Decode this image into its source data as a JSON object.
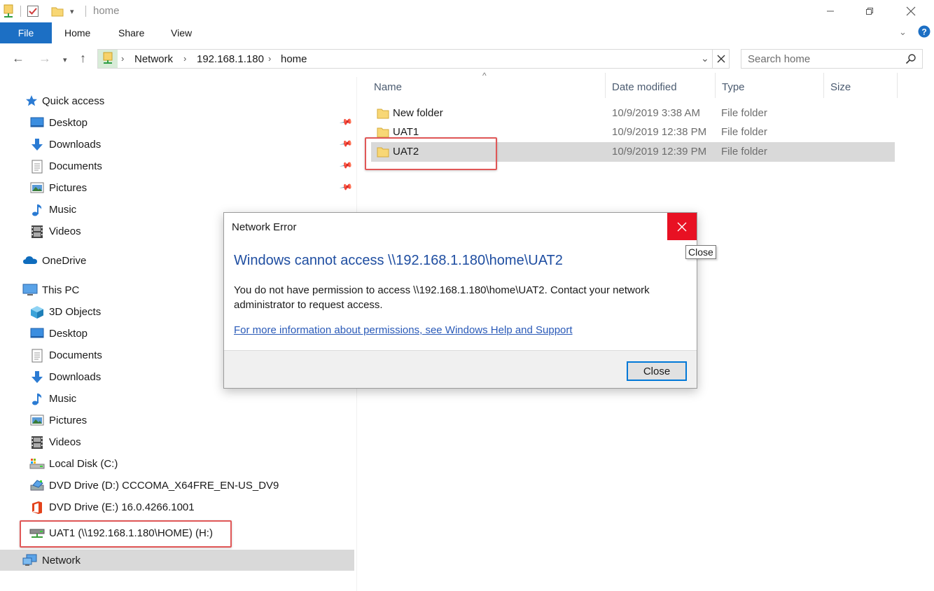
{
  "window": {
    "title": "home",
    "minimize_icon": "minimize-icon",
    "restore_icon": "restore-icon",
    "close_icon": "close-icon"
  },
  "ribbon": {
    "file": "File",
    "tabs": [
      "Home",
      "Share",
      "View"
    ]
  },
  "address": {
    "crumbs": [
      "Network",
      "192.168.1.180",
      "home"
    ]
  },
  "search": {
    "placeholder": "Search home"
  },
  "nav": {
    "quick_access": "Quick access",
    "quick_items": [
      "Desktop",
      "Downloads",
      "Documents",
      "Pictures",
      "Music",
      "Videos"
    ],
    "onedrive": "OneDrive",
    "this_pc": "This PC",
    "pc_items": [
      "3D Objects",
      "Desktop",
      "Documents",
      "Downloads",
      "Music",
      "Pictures",
      "Videos",
      "Local Disk (C:)",
      "DVD Drive (D:) CCCOMA_X64FRE_EN-US_DV9",
      "DVD Drive (E:) 16.0.4266.1001",
      "UAT1 (\\\\192.168.1.180\\HOME) (H:)"
    ],
    "network": "Network"
  },
  "columns": {
    "name": "Name",
    "date": "Date modified",
    "type": "Type",
    "size": "Size"
  },
  "files": [
    {
      "name": "New folder",
      "date": "10/9/2019 3:38 AM",
      "type": "File folder"
    },
    {
      "name": "UAT1",
      "date": "10/9/2019 12:38 PM",
      "type": "File folder"
    },
    {
      "name": "UAT2",
      "date": "10/9/2019 12:39 PM",
      "type": "File folder"
    }
  ],
  "dialog": {
    "title": "Network Error",
    "heading": "Windows cannot access \\\\192.168.1.180\\home\\UAT2",
    "message": "You do not have permission to access \\\\192.168.1.180\\home\\UAT2. Contact your network administrator to request access.",
    "link": "For more information about permissions, see Windows Help and Support",
    "close_button": "Close",
    "tooltip": "Close"
  },
  "colors": {
    "accent": "#1c6fc4",
    "close_red": "#e81123",
    "highlight_red": "#e05757",
    "heading_blue": "#1f4ea1"
  }
}
